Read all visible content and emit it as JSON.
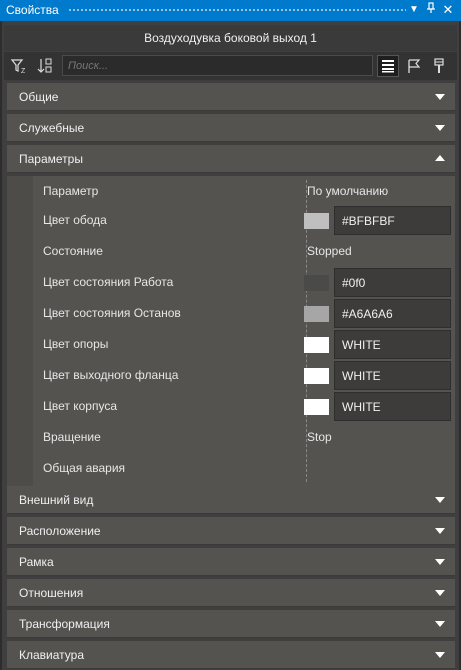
{
  "panel": {
    "title": "Свойства"
  },
  "object_name": "Воздуходувка боковой выход 1",
  "search": {
    "placeholder": "Поиск..."
  },
  "sections_top": [
    {
      "label": "Общие",
      "expanded": false
    },
    {
      "label": "Служебные",
      "expanded": false
    },
    {
      "label": "Параметры",
      "expanded": true
    }
  ],
  "parameters": {
    "header": {
      "name": "Параметр",
      "value": "По умолчанию"
    },
    "rows": [
      {
        "name": "Цвет обода",
        "value": "#BFBFBF",
        "swatch": "#bfbfbf"
      },
      {
        "name": "Состояние",
        "value": "Stopped"
      },
      {
        "name": "Цвет состояния Работа",
        "value": "#0f0",
        "swatch": "#4a4a48"
      },
      {
        "name": "Цвет состояния Останов",
        "value": "#A6A6A6",
        "swatch": "#a6a6a6"
      },
      {
        "name": "Цвет опоры",
        "value": "WHITE",
        "swatch": "#ffffff"
      },
      {
        "name": "Цвет выходного фланца",
        "value": "WHITE",
        "swatch": "#ffffff"
      },
      {
        "name": "Цвет корпуса",
        "value": "WHITE",
        "swatch": "#ffffff"
      },
      {
        "name": "Вращение",
        "value": "Stop"
      },
      {
        "name": "Общая авария",
        "value": ""
      }
    ]
  },
  "sections_bottom": [
    {
      "label": "Внешний вид"
    },
    {
      "label": "Расположение"
    },
    {
      "label": "Рамка"
    },
    {
      "label": "Отношения"
    },
    {
      "label": "Трансформация"
    },
    {
      "label": "Клавиатура"
    }
  ],
  "colors": {
    "accent": "#007acc",
    "section_bg": "#545350",
    "panel_bg": "#3f3f3f"
  }
}
